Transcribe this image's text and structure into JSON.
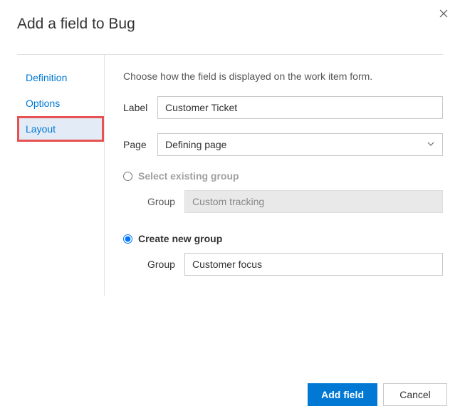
{
  "title": "Add a field to Bug",
  "tabs": {
    "definition": "Definition",
    "options": "Options",
    "layout": "Layout"
  },
  "pane": {
    "helper": "Choose how the field is displayed on the work item form.",
    "label_field": {
      "label": "Label",
      "value": "Customer Ticket"
    },
    "page_field": {
      "label": "Page",
      "value": "Defining page"
    },
    "existing_group": {
      "radio_label": "Select existing group",
      "group_label": "Group",
      "group_value": "Custom tracking"
    },
    "new_group": {
      "radio_label": "Create new group",
      "group_label": "Group",
      "group_value": "Customer focus"
    }
  },
  "footer": {
    "primary": "Add field",
    "cancel": "Cancel"
  }
}
